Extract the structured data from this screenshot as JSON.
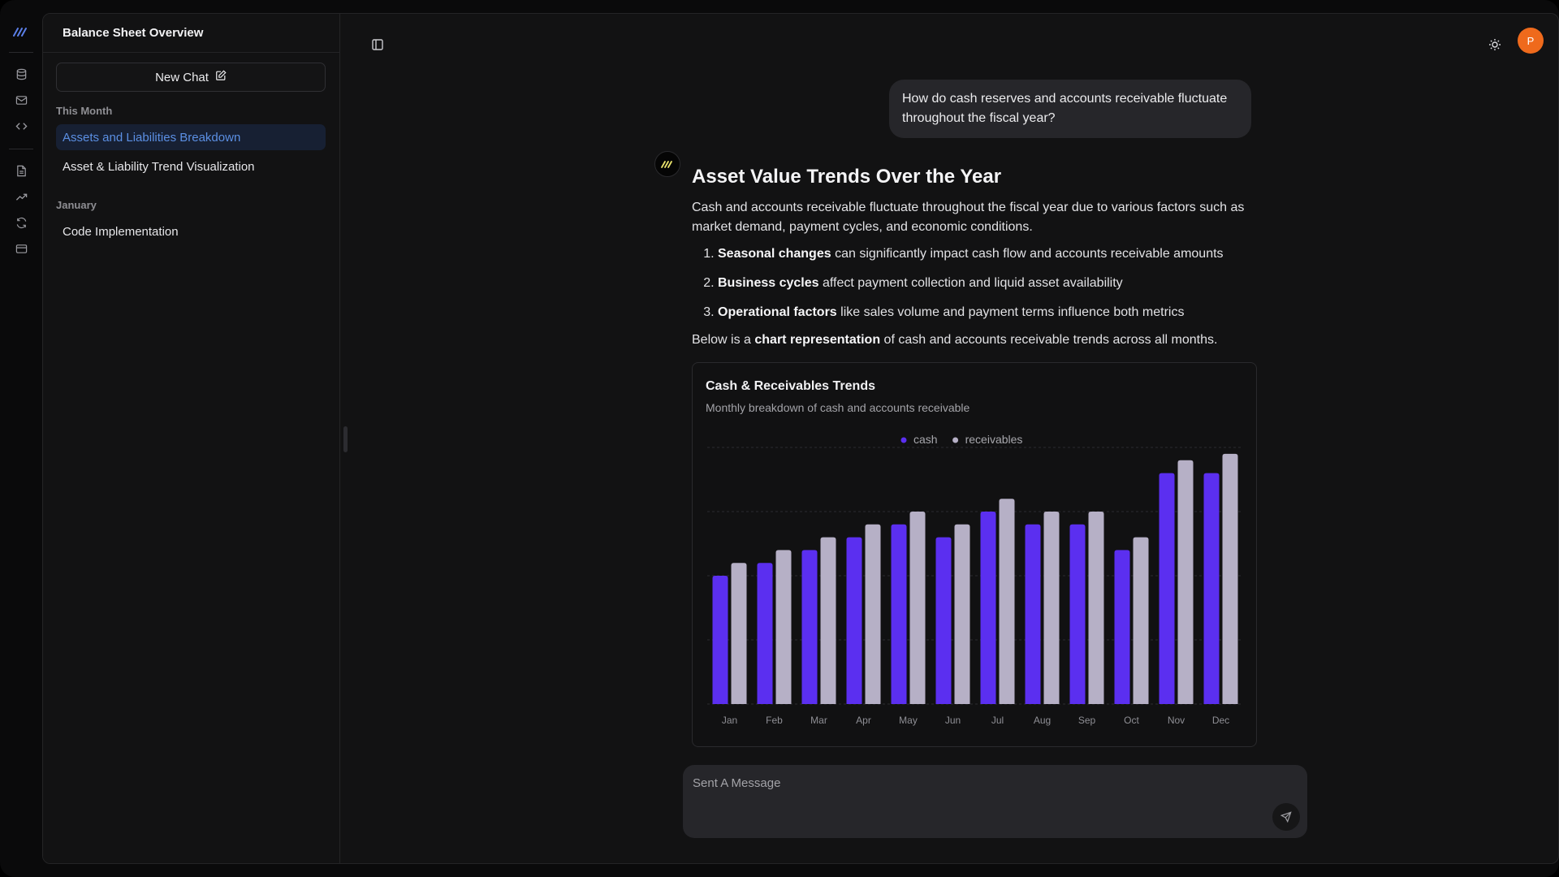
{
  "sidebar": {
    "title": "Balance Sheet Overview",
    "new_chat_label": "New Chat",
    "groups": [
      {
        "label": "This Month",
        "items": [
          "Assets and Liabilities Breakdown",
          "Asset & Liability Trend Visualization"
        ]
      },
      {
        "label": "January",
        "items": [
          "Code Implementation"
        ]
      }
    ],
    "active_item": "Assets and Liabilities Breakdown"
  },
  "rail_icons": [
    "logo-icon",
    "database-icon",
    "mail-icon",
    "code-icon",
    "document-icon",
    "trending-up-icon",
    "refresh-icon",
    "card-icon"
  ],
  "header": {
    "avatar_initial": "P"
  },
  "conversation": {
    "user_message": "How do cash reserves and accounts receivable fluctuate throughout the fiscal year?",
    "answer": {
      "heading": "Asset Value Trends Over the Year",
      "intro": "Cash and accounts receivable fluctuate throughout the fiscal year due to various factors such as market demand, payment cycles, and economic conditions.",
      "points": [
        {
          "bold": "Seasonal changes",
          "text": " can significantly impact cash flow and accounts receivable amounts"
        },
        {
          "bold": "Business cycles",
          "text": " affect payment collection and liquid asset availability"
        },
        {
          "bold": "Operational factors",
          "text": " like sales volume and payment terms influence both metrics"
        }
      ],
      "outro_before": "Below is a ",
      "outro_bold": "chart representation",
      "outro_after": " of cash and accounts receivable trends across all months."
    }
  },
  "chart_card": {
    "title": "Cash & Receivables Trends",
    "subtitle": "Monthly breakdown of cash and accounts receivable"
  },
  "chart_data": {
    "type": "bar",
    "title": "Cash & Receivables Trends",
    "subtitle": "Monthly breakdown of cash and accounts receivable",
    "categories": [
      "Jan",
      "Feb",
      "Mar",
      "Apr",
      "May",
      "Jun",
      "Jul",
      "Aug",
      "Sep",
      "Oct",
      "Nov",
      "Dec"
    ],
    "series": [
      {
        "name": "cash",
        "color": "#5b2ff0",
        "values": [
          10,
          11,
          12,
          13,
          14,
          13,
          15,
          14,
          14,
          12,
          18,
          18
        ]
      },
      {
        "name": "receivables",
        "color": "#b6b0c6",
        "values": [
          11,
          12,
          13,
          14,
          15,
          14,
          16,
          15,
          15,
          13,
          19,
          19.5
        ]
      }
    ],
    "ylim": [
      0,
      20
    ],
    "grid": true,
    "legend": "top-center"
  },
  "composer": {
    "placeholder": "Sent A Message"
  }
}
